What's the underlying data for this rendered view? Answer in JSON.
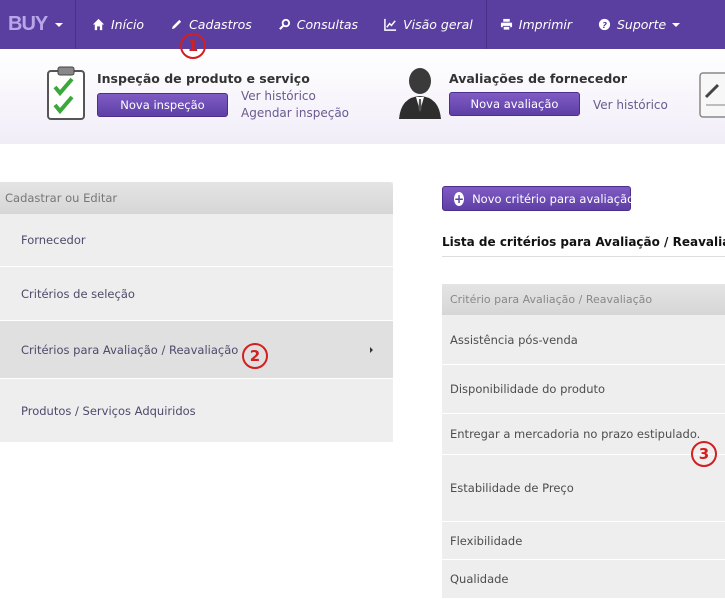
{
  "topnav": {
    "brand": "BUY",
    "items": [
      {
        "label": "Início",
        "icon": "home-icon"
      },
      {
        "label": "Cadastros",
        "icon": "pencil-icon"
      },
      {
        "label": "Consultas",
        "icon": "search-icon"
      },
      {
        "label": "Visão geral",
        "icon": "chart-icon"
      },
      {
        "label": "Imprimir",
        "icon": "print-icon"
      },
      {
        "label": "Suporte",
        "icon": "help-icon"
      }
    ]
  },
  "quick": {
    "inspection": {
      "title": "Inspeção de produto e serviço",
      "button": "Nova inspeção",
      "link_history": "Ver histórico",
      "link_schedule": "Agendar inspeção"
    },
    "evaluation": {
      "title": "Avaliações de fornecedor",
      "button": "Nova avaliação",
      "link_history": "Ver histórico"
    }
  },
  "leftmenu": {
    "header": "Cadastrar ou Editar",
    "items": [
      "Fornecedor",
      "Critérios de seleção",
      "Critérios para Avaliação / Reavaliação",
      "Produtos / Serviços Adquiridos"
    ]
  },
  "main": {
    "new_button": "Novo critério para avaliação",
    "list_title": "Lista de critérios para Avaliação / Reavaliação",
    "table_header": "Critério para Avaliação / Reavaliação",
    "rows": [
      "Assistência pós-venda",
      "Disponibilidade do produto",
      "Entregar a mercadoria no prazo estipulado.",
      "Estabilidade de Preço",
      "Flexibilidade",
      "Qualidade"
    ]
  },
  "annotations": [
    "1",
    "2",
    "3"
  ],
  "colors": {
    "nav_bg": "#5b3fa0",
    "button_bg": "#6a4bb3",
    "marker": "#d21f1f"
  }
}
